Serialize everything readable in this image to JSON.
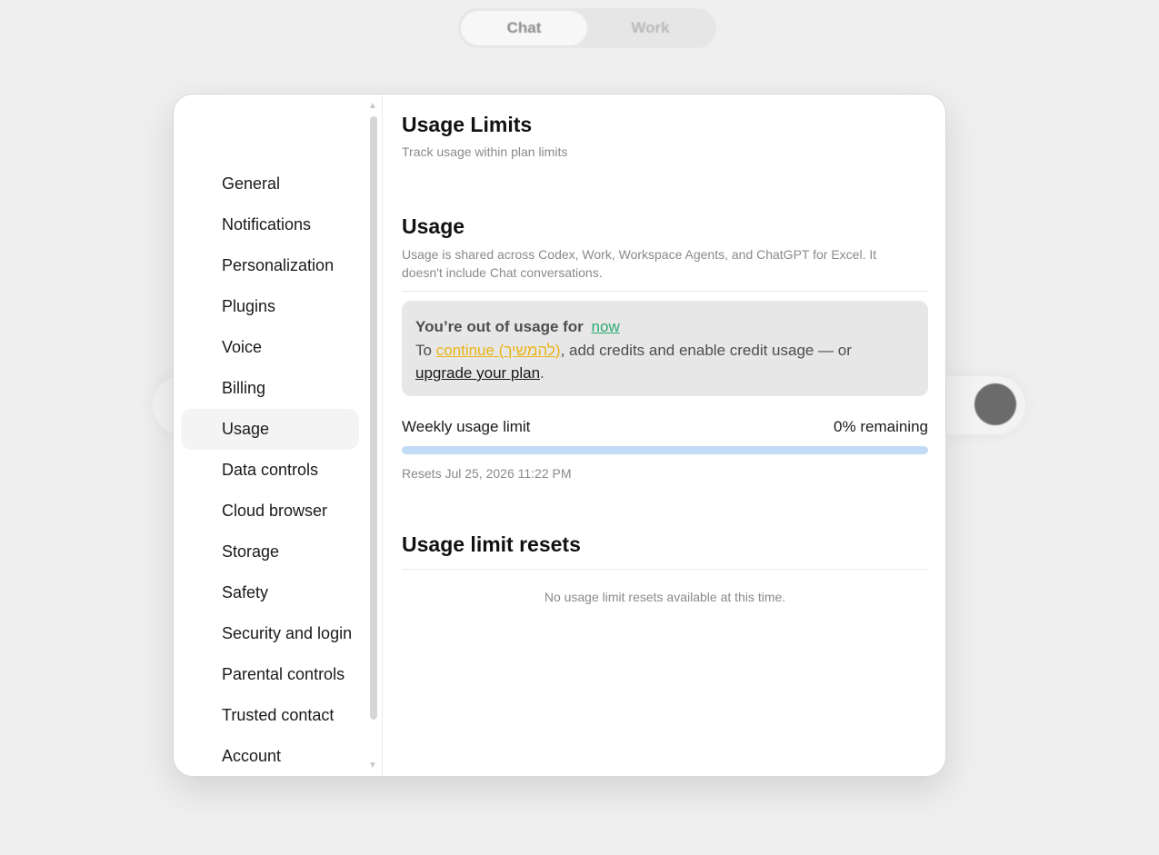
{
  "top_toggle": {
    "chat_label": "Chat",
    "work_label": "Work"
  },
  "sidebar": {
    "items": [
      {
        "label": "General"
      },
      {
        "label": "Notifications"
      },
      {
        "label": "Personalization"
      },
      {
        "label": "Plugins"
      },
      {
        "label": "Voice"
      },
      {
        "label": "Billing"
      },
      {
        "label": "Usage",
        "active": true
      },
      {
        "label": "Data controls"
      },
      {
        "label": "Cloud browser"
      },
      {
        "label": "Storage"
      },
      {
        "label": "Safety"
      },
      {
        "label": "Security and login"
      },
      {
        "label": "Parental controls"
      },
      {
        "label": "Trusted contact"
      },
      {
        "label": "Account"
      }
    ]
  },
  "content": {
    "title": "Usage Limits",
    "subtitle": "Track usage within plan limits",
    "usage": {
      "title": "Usage",
      "description": "Usage is shared across Codex, Work, Workspace Agents, and ChatGPT for Excel. It doesn't include Chat conversations."
    },
    "alert": {
      "out_text": "You’re out of usage for",
      "now_link": "now",
      "to_text": "To ",
      "continue_link": "continue (להמשיך)",
      "middle_text": ", add credits and enable credit usage — or",
      "upgrade_link": "upgrade your plan",
      "end_text": "."
    },
    "weekly": {
      "label": "Weekly usage limit",
      "remaining": "0% remaining",
      "fraction_used": 0,
      "resets": "Resets Jul 25, 2026 11:22 PM"
    },
    "resets_section": {
      "title": "Usage limit resets",
      "empty_text": "No usage limit resets available at this time."
    }
  },
  "colors": {
    "accent_green": "#2daa75",
    "accent_yellow": "#e9b416",
    "progress_track": "#c2dcf6"
  }
}
